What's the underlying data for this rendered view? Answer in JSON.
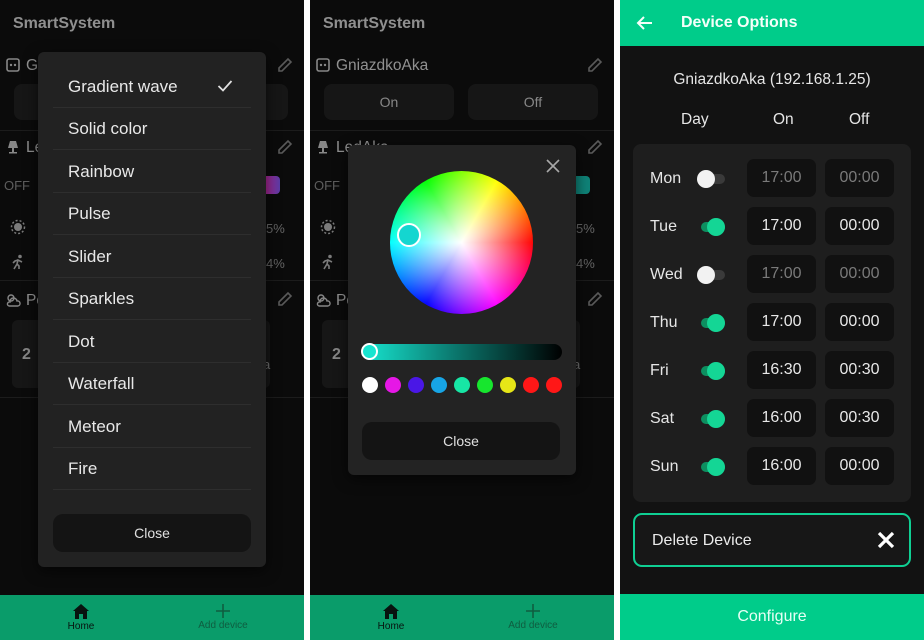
{
  "app": {
    "title": "SmartSystem"
  },
  "home": {
    "devices": [
      {
        "name": "GniazdkoAka",
        "on_label": "On",
        "off_label": "Off"
      },
      {
        "name": "LedAka",
        "state_label": "OFF",
        "brightness": "5%",
        "speed": "4%"
      },
      {
        "name": "Pogoda",
        "value_fragment": "2",
        "unit_fragment": "a"
      }
    ],
    "nav": {
      "home": "Home",
      "add": "Add device"
    }
  },
  "effects_menu": {
    "items": [
      "Gradient wave",
      "Solid color",
      "Rainbow",
      "Pulse",
      "Slider",
      "Sparkles",
      "Dot",
      "Waterfall",
      "Meteor",
      "Fire"
    ],
    "selected": "Gradient wave",
    "close_label": "Close"
  },
  "color_dialog": {
    "selected_color": "#17e5d0",
    "presets": [
      "#ffffff",
      "#e617e6",
      "#4a17e6",
      "#17a5e6",
      "#17e6a5",
      "#17e62e",
      "#e6e617",
      "#ff1717",
      "#ff1717"
    ],
    "close_label": "Close"
  },
  "device_options": {
    "title": "Device Options",
    "device": "GniazdkoAka (192.168.1.25)",
    "columns": {
      "day": "Day",
      "on": "On",
      "off": "Off"
    },
    "rows": [
      {
        "day": "Mon",
        "enabled": false,
        "on": "17:00",
        "off": "00:00"
      },
      {
        "day": "Tue",
        "enabled": true,
        "on": "17:00",
        "off": "00:00"
      },
      {
        "day": "Wed",
        "enabled": false,
        "on": "17:00",
        "off": "00:00"
      },
      {
        "day": "Thu",
        "enabled": true,
        "on": "17:00",
        "off": "00:00"
      },
      {
        "day": "Fri",
        "enabled": true,
        "on": "16:30",
        "off": "00:30"
      },
      {
        "day": "Sat",
        "enabled": true,
        "on": "16:00",
        "off": "00:30"
      },
      {
        "day": "Sun",
        "enabled": true,
        "on": "16:00",
        "off": "00:00"
      }
    ],
    "delete_label": "Delete Device",
    "configure_label": "Configure"
  },
  "colors": {
    "accent": "#00cc8a",
    "nav": "#0a9c6a",
    "background": "#121212"
  }
}
